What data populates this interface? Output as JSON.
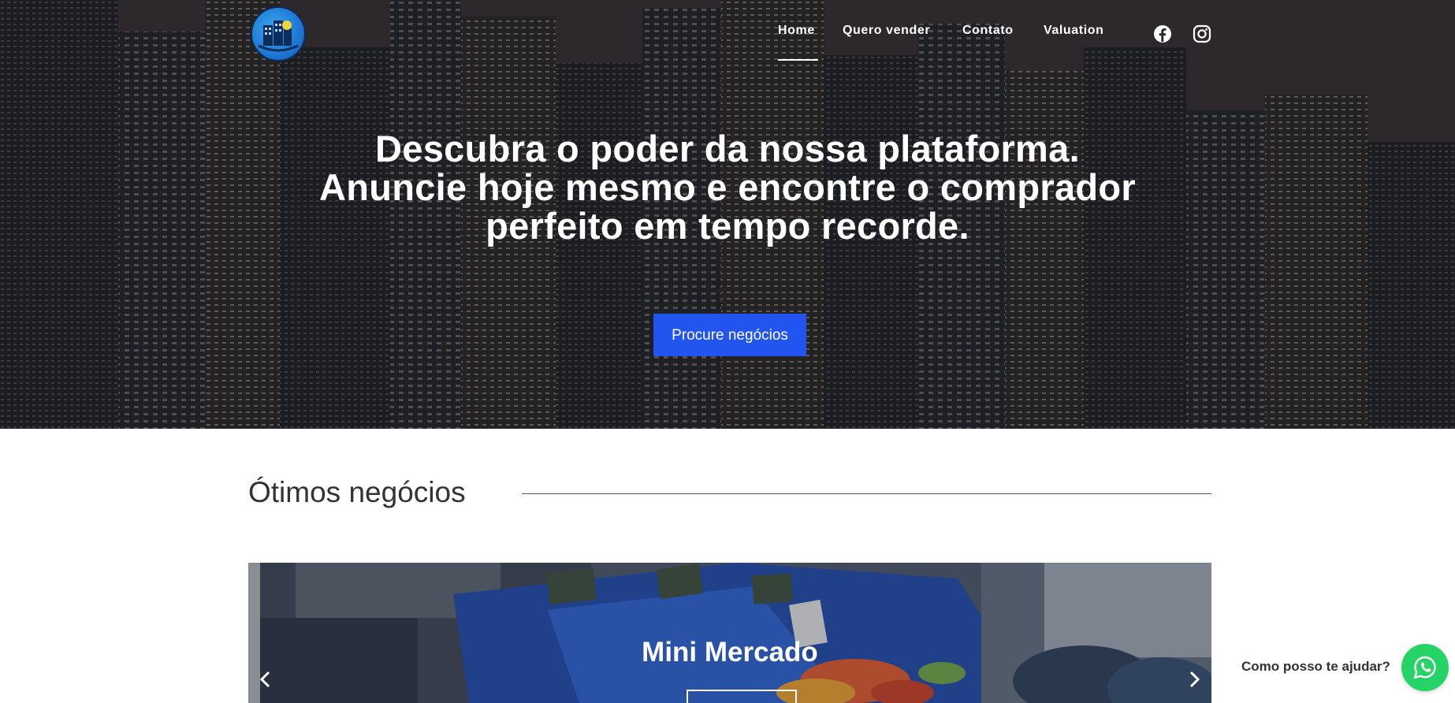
{
  "nav": {
    "items": [
      {
        "label": "Home",
        "active": true
      },
      {
        "label": "Quero vender",
        "active": false
      },
      {
        "label": "Contato",
        "active": false
      },
      {
        "label": "Valuation",
        "active": false
      }
    ],
    "social": [
      "facebook-icon",
      "instagram-icon"
    ]
  },
  "hero": {
    "title_lines": [
      "Descubra o poder da nossa plataforma.",
      "Anuncie hoje mesmo e encontre o comprador",
      "perfeito em tempo recorde."
    ],
    "cta_label": "Procure negócios"
  },
  "section": {
    "title": "Ótimos negócios"
  },
  "carousel": {
    "slide_title": "Mini Mercado",
    "prev_icon": "chevron-left-icon",
    "next_icon": "chevron-right-icon"
  },
  "chat": {
    "label": "Como posso te ajudar?",
    "icon": "whatsapp-icon"
  },
  "colors": {
    "accent": "#2255f0",
    "whatsapp": "#25d366"
  }
}
